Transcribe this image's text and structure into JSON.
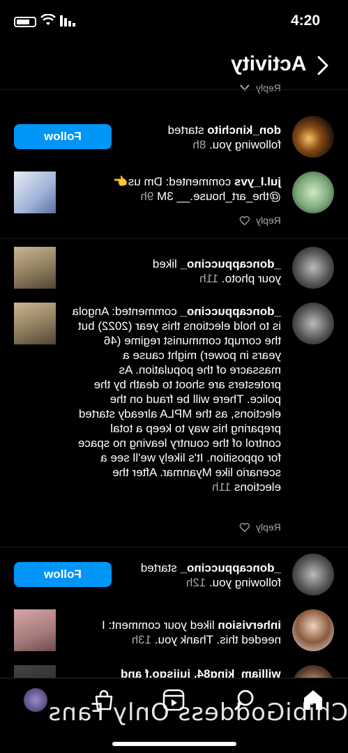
{
  "status_bar": {
    "time": "4:20"
  },
  "header": {
    "title": "Activity"
  },
  "feed": {
    "reply_label": "Reply",
    "items": [
      {
        "user": "don_kinchito",
        "action": " started following you.",
        "time": "8h",
        "button": "Follow"
      },
      {
        "user": "jul.l_yvs",
        "action": " commented: Dm us👉 @the_art_house.__ 3M",
        "time": "9h"
      },
      {
        "user": "_doncappuccino_",
        "action": " liked your photo.",
        "time": "11h"
      },
      {
        "user": "_doncappuccino_",
        "action": " commented: Angola is to hold elections this year (2022) but the corrupt communist regime (46 years in power) might cause a massacre of the population. As protesters are shoot to death by the police. There will be fraud on the elections, as the MPLA already started preparing his way to keep a total control of the country leaving no space for opposition. It's likely we'll see a scenario like Myanmar. After the elections",
        "time": "11h"
      },
      {
        "user": "_doncappuccino_",
        "action": " started following you.",
        "time": "12h",
        "button": "Follow"
      },
      {
        "user": "inhervision",
        "action": " liked your comment: I needed this. Thank you.",
        "time": "13h"
      },
      {
        "user": "william_king84, juiisgo.f and",
        "action": "",
        "time": ""
      }
    ]
  },
  "watermark": "ChibiGoddess Only Fans",
  "colors": {
    "accent": "#0095f6",
    "muted": "#a8a8a8"
  }
}
